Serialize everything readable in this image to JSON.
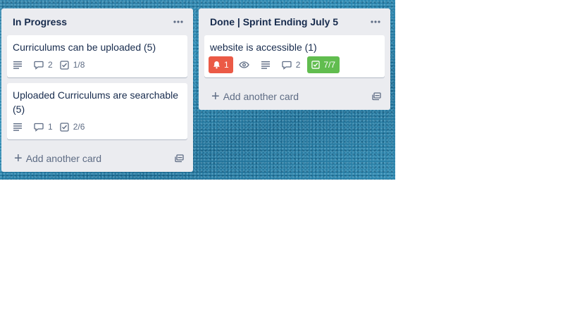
{
  "lists": [
    {
      "title": "In Progress",
      "menu_icon": "ellipsis-icon",
      "cards": [
        {
          "title": "Curriculums can be uploaded (5)",
          "comments": "2",
          "checklist": "1/8"
        },
        {
          "title": "Uploaded Curriculums are searchable (5)",
          "comments": "1",
          "checklist": "2/6"
        }
      ],
      "add_card_label": "Add another card"
    },
    {
      "title": "Done | Sprint Ending July 5",
      "menu_icon": "ellipsis-icon",
      "cards": [
        {
          "title": "website is accessible (1)",
          "notifications": "1",
          "comments": "2",
          "checklist": "7/7"
        }
      ],
      "add_card_label": "Add another card"
    }
  ],
  "colors": {
    "notification_badge": "#eb5a46",
    "checklist_complete": "#61bd4f",
    "list_bg": "#ebecf0"
  }
}
